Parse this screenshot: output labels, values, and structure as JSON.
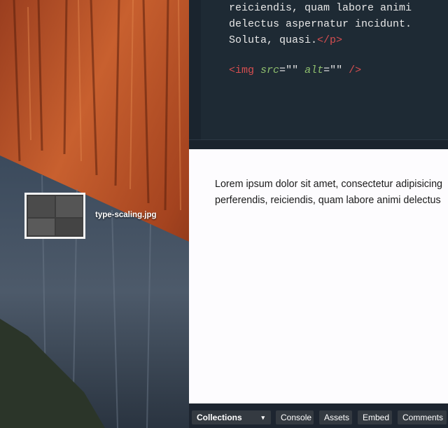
{
  "code_editor": {
    "lines": [
      {
        "text": "reiciendis, quam labore animi"
      },
      {
        "text": "delectus aspernatur incidunt."
      },
      {
        "prefix": "Soluta, quasi.",
        "close_tag": "</p>"
      },
      {
        "img_open": "<img",
        "attr1": "src",
        "eq1": "=",
        "val1": "\"\"",
        "attr2": "alt",
        "eq2": "=",
        "val2": "\"\"",
        "img_close": "/>"
      }
    ]
  },
  "preview": {
    "line1": "Lorem ipsum dolor sit amet, consectetur adipisicing",
    "line2": "perferendis, reiciendis, quam labore animi delectus"
  },
  "drag_file": {
    "name": "type-scaling.jpg"
  },
  "footer": {
    "collections_label": "Collections",
    "collections_caret": "▾",
    "console_label": "Console",
    "assets_label": "Assets",
    "embed_label": "Embed",
    "comments_label": "Comments"
  },
  "colors": {
    "editor_bg": "#1e2a34",
    "tag": "#d64e50",
    "attribute": "#8fbf6e",
    "preview_bg": "#fdfcfe",
    "footer_bg": "#1d2530",
    "footer_button": "#343a41"
  }
}
